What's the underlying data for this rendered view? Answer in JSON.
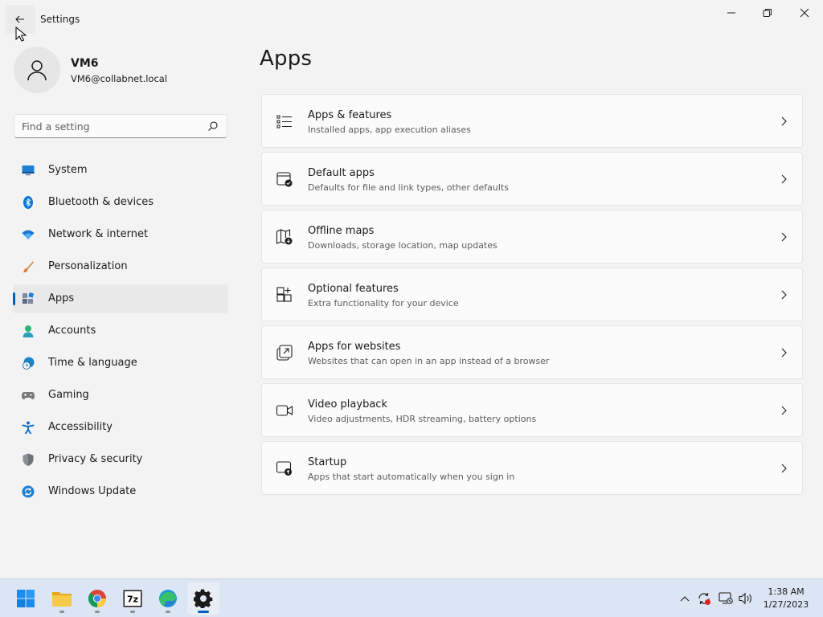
{
  "window": {
    "title": "Settings"
  },
  "profile": {
    "name": "VM6",
    "email": "VM6@collabnet.local"
  },
  "search": {
    "placeholder": "Find a setting"
  },
  "nav": [
    {
      "label": "System",
      "icon": "monitor-icon",
      "color": "#1f7fd4"
    },
    {
      "label": "Bluetooth & devices",
      "icon": "bluetooth-icon",
      "color": "#0a78d7"
    },
    {
      "label": "Network & internet",
      "icon": "wifi-icon",
      "color": "#1976d2"
    },
    {
      "label": "Personalization",
      "icon": "brush-icon",
      "color": "#e07b3c"
    },
    {
      "label": "Apps",
      "icon": "apps-icon",
      "color": "#5b6b85",
      "active": true
    },
    {
      "label": "Accounts",
      "icon": "person-icon",
      "color": "#2fb57a"
    },
    {
      "label": "Time & language",
      "icon": "globe-clock-icon",
      "color": "#1a86c7"
    },
    {
      "label": "Gaming",
      "icon": "controller-icon",
      "color": "#7a7a7a"
    },
    {
      "label": "Accessibility",
      "icon": "accessibility-icon",
      "color": "#1570c8"
    },
    {
      "label": "Privacy & security",
      "icon": "shield-icon",
      "color": "#8a8f96"
    },
    {
      "label": "Windows Update",
      "icon": "sync-icon",
      "color": "#1f7fd4"
    }
  ],
  "main": {
    "title": "Apps",
    "cards": [
      {
        "title": "Apps & features",
        "subtitle": "Installed apps, app execution aliases",
        "icon": "list-icon"
      },
      {
        "title": "Default apps",
        "subtitle": "Defaults for file and link types, other defaults",
        "icon": "default-apps-icon"
      },
      {
        "title": "Offline maps",
        "subtitle": "Downloads, storage location, map updates",
        "icon": "map-download-icon"
      },
      {
        "title": "Optional features",
        "subtitle": "Extra functionality for your device",
        "icon": "grid-add-icon"
      },
      {
        "title": "Apps for websites",
        "subtitle": "Websites that can open in an app instead of a browser",
        "icon": "open-in-app-icon"
      },
      {
        "title": "Video playback",
        "subtitle": "Video adjustments, HDR streaming, battery options",
        "icon": "video-icon"
      },
      {
        "title": "Startup",
        "subtitle": "Apps that start automatically when you sign in",
        "icon": "startup-icon"
      }
    ]
  },
  "taskbar": {
    "apps": [
      "windows-start-icon",
      "file-explorer-icon",
      "chrome-icon",
      "7zip-icon",
      "edge-icon",
      "settings-icon"
    ],
    "zip_label": "7z",
    "time": "1:38 AM",
    "date": "1/27/2023"
  },
  "colors": {
    "accent": "#005fb8",
    "taskbar": "#dce5f3",
    "background": "#f3f3f3"
  }
}
